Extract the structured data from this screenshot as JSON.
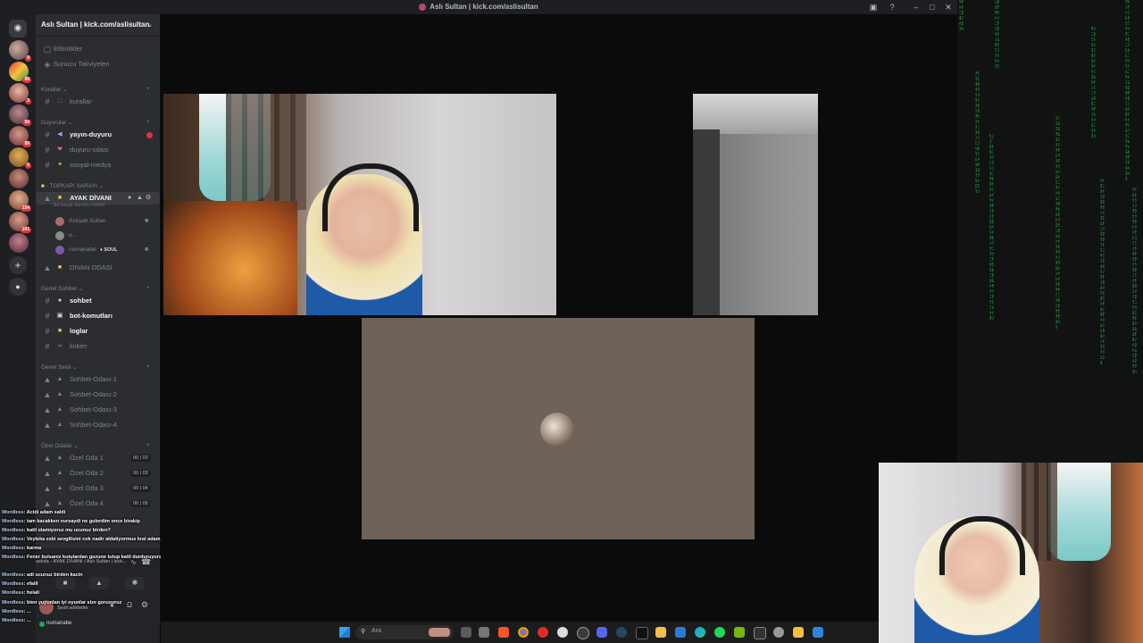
{
  "window": {
    "title": "Aslı Sultan | kick.com/aslisultan"
  },
  "rail": {
    "badges": [
      "9",
      "99",
      "3",
      "",
      "50",
      "99",
      "5",
      "134",
      "101",
      "",
      ""
    ]
  },
  "sidebar": {
    "server_name": "Aslı Sultan | kick.com/aslisultan",
    "top_items": [
      "Etkinlikler",
      "Sunucu Takviyeleri"
    ],
    "categories": {
      "kurallar": "Kurallar",
      "duyurular": "Duyurular",
      "topkapi": "TOPKAPI SARAYI",
      "genel_sohbet": "Genel Sohbet",
      "genel_sesli": "Genel Sesli",
      "ozel_odalar": "Özel Odalar"
    },
    "channels": {
      "kurallar": "kurallar",
      "yayin_duyuru": "yayın-duyuru",
      "duyuru_odasi": "duyuru-odası",
      "sosyal_medya": "sosyal-medya",
      "ayak_divani": "AYAK DİVANI",
      "voice_status": "Bir kanal durumu belirle",
      "member1": "Aslışah Sultan",
      "member2": "v...",
      "member3": "numanabe",
      "member3_tag": "SOUL",
      "divan_odasi": "DİVAN ODASI",
      "sohbet": "sohbet",
      "bot_komutlari": "bot-komutları",
      "loglar": "loglar",
      "linkler": "linkler",
      "sohbet_odasi_1": "Sohbet-Odası-1",
      "sohbet_odasi_2": "Sohbet-Odası-2",
      "sohbet_odasi_3": "Sohbet-Odası-3",
      "sohbet_odasi_4": "Sohbet-Odası-4",
      "ozel_oda_1": "Özel Oda 1",
      "ozel_oda_2": "Özel Oda 2",
      "ozel_oda_3": "Özel Oda 3",
      "ozel_oda_4": "Özel Oda 4"
    },
    "ozel_counts": [
      [
        "00",
        "02"
      ],
      [
        "00",
        "03"
      ],
      [
        "00",
        "04"
      ],
      [
        "00",
        "05"
      ]
    ],
    "voice_panel": "aslıda - AYAK DİVANI / Aslı Sultan | kick...",
    "user_status": "Sesli sohbette",
    "username": "numanabe"
  },
  "chat_overlay": [
    {
      "user": "Wordless",
      "msg": ": Acidi adam saldi"
    },
    {
      "user": "Wordless",
      "msg": ": tam kacakken vursaydi ne gulerdim once birakip"
    },
    {
      "user": "Wordless",
      "msg": ": katil olamiyoruz mu ucunuz birden?"
    },
    {
      "user": "Wordless",
      "msg": ": Veyleka eski sevgilisini cok nadir aldatiyormus kral adam"
    },
    {
      "user": "Wordless",
      "msg": ": karma"
    },
    {
      "user": "Wordless",
      "msg": ": Fener bulsaniz kutulardan gozune tutup katil durduruyorsunuz"
    },
    {
      "user": "Wordless",
      "msg": ": adi ucunuz birden kacin"
    },
    {
      "user": "Wordless",
      "msg": ": efalil"
    },
    {
      "user": "Wordless",
      "msg": ": helali"
    },
    {
      "user": "Wordless",
      "msg": ": bien yuyunlan iyi oyunlar size gorusuruz"
    },
    {
      "user": "Wordless",
      "msg": ": ..."
    },
    {
      "user": "Wordless",
      "msg": ": ..."
    }
  ],
  "taskbar": {
    "search_placeholder": "Ara",
    "icons": [
      "windows-icon",
      "search-icon",
      "task-view-icon",
      "widgets-icon",
      "brave-icon",
      "chrome-icon",
      "opera-icon",
      "github-icon",
      "obs-icon",
      "discord-icon",
      "steam-icon",
      "tiktok-icon",
      "notes-icon",
      "vscode-icon",
      "edge-icon",
      "spotify-icon",
      "nvidia-icon",
      "terminal-icon",
      "settings-icon",
      "explorer-icon",
      "store-icon"
    ]
  },
  "matrix": {
    "columns": [
      "ﾂﾃﾄﾅﾆﾇﾈﾉﾊﾋﾌﾍ",
      "ﾝﾀｸﾁﾁｹﾄﾒﾆﾁﾐﾀﾈﾒﾉﾑﾀﾗﾘﾌﾂﾊﾘﾊﾗﾜ",
      "ｱｲｳｴｵｶｷｸｹｺｻｼｽｾｿﾀﾁﾂﾃﾄﾅﾆﾇﾈﾉﾊﾋﾌﾍﾎﾏﾐﾑﾒﾓﾔﾕﾖﾗﾘﾙﾚﾛﾜｦﾝ",
      "ﾋﾝｺﾞｾﾄﾀﾆｲﾂｿｸﾄﾝﾎﾆﾁｷﾀﾃﾅﾐﾑｲﾂﾉﾓﾁﾐﾀﾋﾋﾛﾀﾛﾒｼｲﾀﾎﾝﾜﾅﾆｦﾗﾆﾁﾀｸﾘﾎﾆﾀﾈﾓﾄｻｲﾂﾆﾁﾘﾏﾐﾋﾒｲﾀﾌ",
      "ﾘﾉﾗﾑﾜﾛﾁﾑﾓﾐｲﾐﾂﾔﾋﾘｽﾁﾂﾗﾑﾍﾛﾄﾜﾆﾁﾉﾊﾄﾕﾉﾅﾀﾁﾎﾑｷﾋﾘﾛﾂﾆﾀﾑﾋﾄｲﾗﾎﾁﾏﾍﾉﾀｸﾛﾊﾝﾂﾚｲﾘﾀﾔｷﾐﾆﾒﾀﾐﾎﾔｹﾁﾀｶﾊﾗ",
      "ｻｼﾆﾈﾐﾄﾓｼﾇﾐﾀﾉﾎﾐｸｲﾄﾐﾈﾑｹﾁﾝﾐﾆﾘﾑﾈﾀﾆﾂﾁﾐﾋﾘﾒﾓﾆﾘﾅﾇﾊ",
      "ﾊｲﾀﾆｵﾄﾐﾛﾀﾈﾁﾇﾉﾒｸｴﾑﾅﾆﾊﾈｸﾘﾀﾌﾋﾘﾆﾔﾗﾐﾀﾎﾇﾜﾉﾈﾁﾂﾀﾈﾊﾘﾋﾀﾗﾄﾁﾎﾝﾀﾁﾍﾘﾑﾂﾄﾀﾈﾊﾉﾄｳﾏｲﾂﾑｸﾀ",
      "ｱｹﾝﾁﾄﾐﾋﾈﾗﾐﾘﾂﾁﾆｲﾀﾆﾌﾋﾎﾋﾆﾃﾂﾘｲﾊﾆﾁﾄﾐｽﾘﾛﾀﾁﾘﾀﾐﾉﾎﾗﾀﾘﾋﾄﾁﾂﾓﾉﾃﾆﾁﾑﾁﾝﾓﾎﾗﾁﾐﾁｷﾊﾈﾊﾀ",
      "ﾂｲﾑﾄﾘﾗﾉﾝﾁﾀﾋﾘﾁﾈﾊﾗﾄﾁﾋｽﾐﾐﾉﾀﾈﾁﾂﾀﾐﾍﾘﾀﾉﾐﾊﾁﾀﾇﾐﾒﾐﾀﾘﾆﾃﾊﾓﾐﾁﾈﾀﾘﾗﾑﾑﾁﾀﾉﾊﾛﾄﾑﾐﾀﾄﾈﾁﾂﾀﾊ"
    ]
  }
}
